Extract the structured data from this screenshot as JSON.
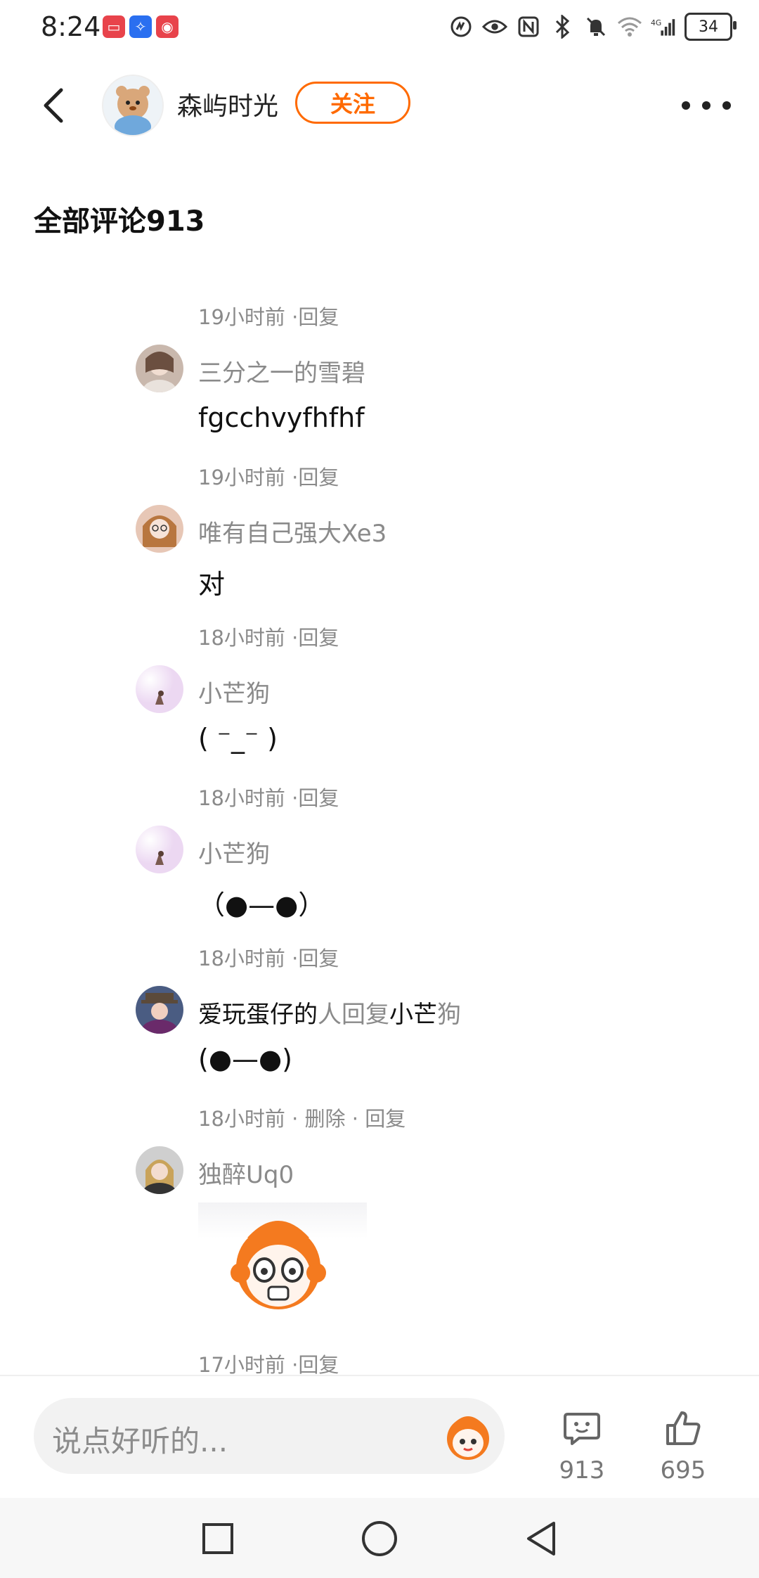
{
  "status_bar": {
    "time": "8:24",
    "battery": "34",
    "icons": [
      "nfc-icon",
      "eye-icon",
      "bluetooth-icon",
      "mute-icon",
      "wifi-icon",
      "signal-icon"
    ]
  },
  "header": {
    "author": "森屿时光",
    "follow_label": "关注"
  },
  "section_title": "全部评论913",
  "top_time": "19小时前 ·回复",
  "comments": [
    {
      "name": "三分之一的雪碧",
      "text": "fgcchvyfhfhf",
      "time": "19小时前 ·回复"
    },
    {
      "name": "唯有自己强大Xe3",
      "text": "对",
      "time": "18小时前 ·回复"
    },
    {
      "name": "小芒狗",
      "text": "( ⁻_⁻ )",
      "time": "18小时前 ·回复"
    },
    {
      "name": "小芒狗",
      "text": "（●—●）",
      "time": "18小时前 ·回复"
    },
    {
      "name_user": "爱玩蛋仔的",
      "name_mid": "人回复",
      "name_target": "小芒",
      "name_tail": "狗",
      "text": "(●—●)",
      "time": "18小时前 · 删除 · 回复"
    },
    {
      "name": "独醉Uq0",
      "text": "",
      "time": "17小时前 ·回复"
    }
  ],
  "bottom": {
    "placeholder": "说点好听的...",
    "comment_count": "913",
    "like_count": "695"
  },
  "colors": {
    "accent": "#ff6a00",
    "meta_text": "#8a8a8a"
  }
}
